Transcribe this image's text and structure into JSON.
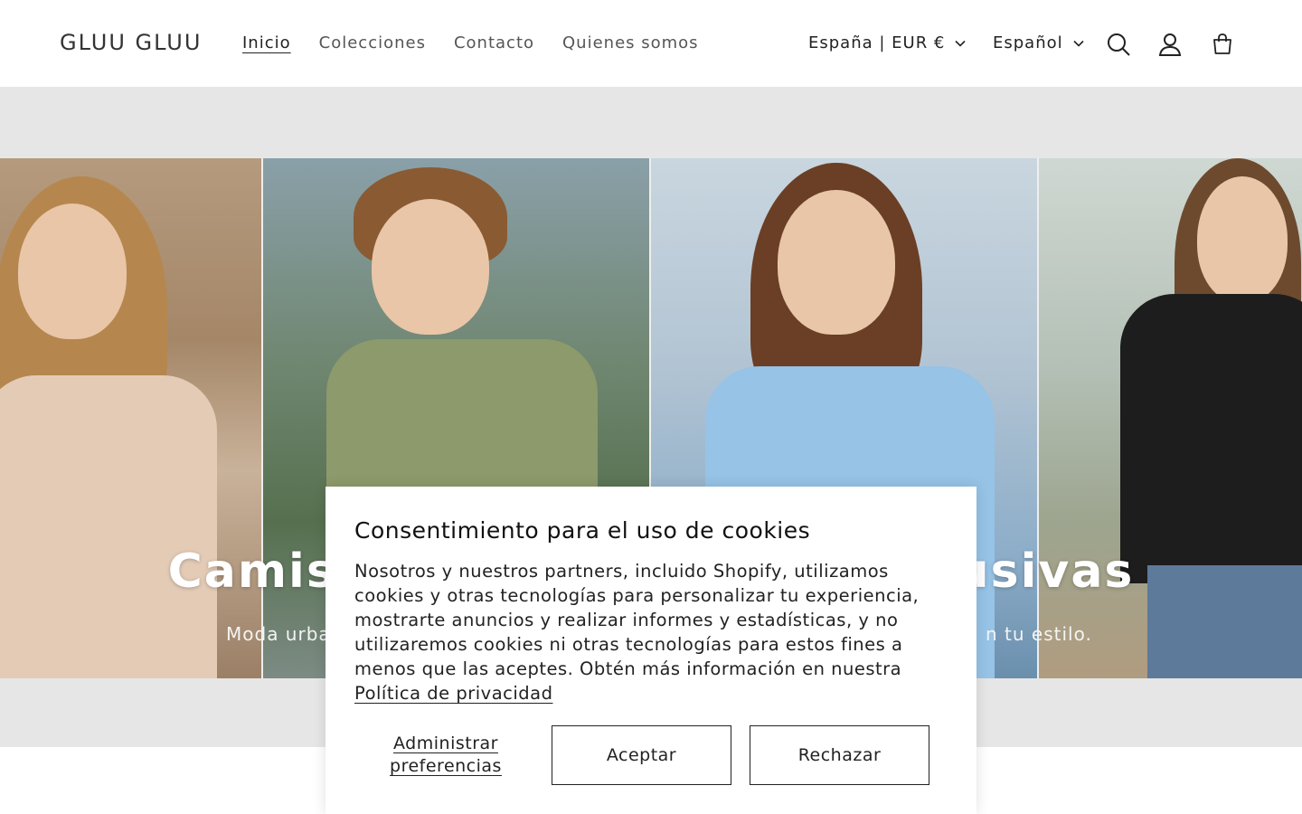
{
  "header": {
    "logo": "GLUU GLUU",
    "nav": [
      {
        "label": "Inicio",
        "active": true
      },
      {
        "label": "Colecciones",
        "active": false
      },
      {
        "label": "Contacto",
        "active": false
      },
      {
        "label": "Quienes somos",
        "active": false
      }
    ],
    "country_selector": "España | EUR €",
    "language_selector": "Español",
    "icons": [
      "search-icon",
      "account-icon",
      "cart-icon"
    ]
  },
  "hero": {
    "title": "Camisetas y Sudaderas exclusivas",
    "subtitle_start": "Moda urba",
    "subtitle_end": "n tu estilo."
  },
  "cookie_banner": {
    "title": "Consentimiento para el uso de cookies",
    "body": "Nosotros y nuestros partners, incluido Shopify, utilizamos cookies y otras tecnologías para personalizar tu experiencia, mostrarte anuncios y realizar informes y estadísticas, y no utilizaremos cookies ni otras tecnologías para estos fines a menos que las aceptes. Obtén más información en nuestra",
    "privacy_link": "Política de privacidad",
    "manage_label": "Administrar preferencias",
    "accept_label": "Aceptar",
    "reject_label": "Rechazar"
  },
  "colors": {
    "hero_bg": "#e6e6e6",
    "text": "#121212",
    "border": "#222222"
  }
}
